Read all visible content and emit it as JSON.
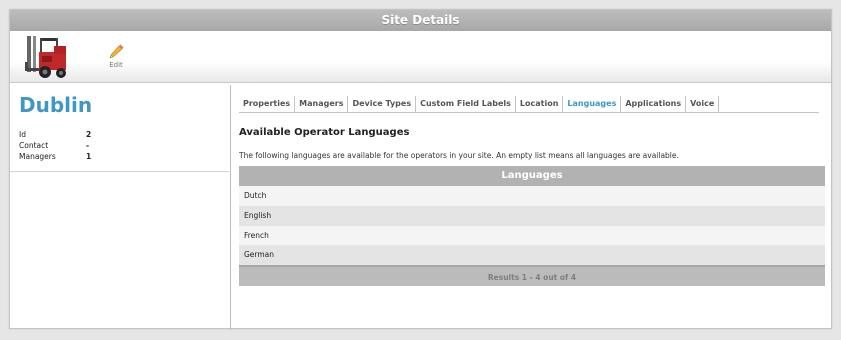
{
  "header": {
    "title": "Site Details"
  },
  "toolbar": {
    "edit_label": "Edit"
  },
  "site": {
    "name": "Dublin",
    "info": [
      {
        "label": "Id",
        "value": "2"
      },
      {
        "label": "Contact",
        "value": "-"
      },
      {
        "label": "Managers",
        "value": "1"
      }
    ]
  },
  "tabs": [
    {
      "label": "Properties",
      "active": false
    },
    {
      "label": "Managers",
      "active": false
    },
    {
      "label": "Device Types",
      "active": false
    },
    {
      "label": "Custom Field Labels",
      "active": false
    },
    {
      "label": "Location",
      "active": false
    },
    {
      "label": "Languages",
      "active": true
    },
    {
      "label": "Applications",
      "active": false
    },
    {
      "label": "Voice",
      "active": false
    }
  ],
  "content": {
    "heading": "Available Operator Languages",
    "description": "The following languages are available for the operators in your site. An empty list means all languages are available."
  },
  "languages_table": {
    "header": "Languages",
    "rows": [
      "Dutch",
      "English",
      "French",
      "German"
    ],
    "footer": "Results 1 - 4 out of 4"
  },
  "colors": {
    "accent": "#3f97c6",
    "titlebar": "#a8a8a8",
    "grid_header": "#b2b2b2"
  },
  "icons": {
    "logo": "forklift-icon",
    "edit": "pencil-icon"
  }
}
